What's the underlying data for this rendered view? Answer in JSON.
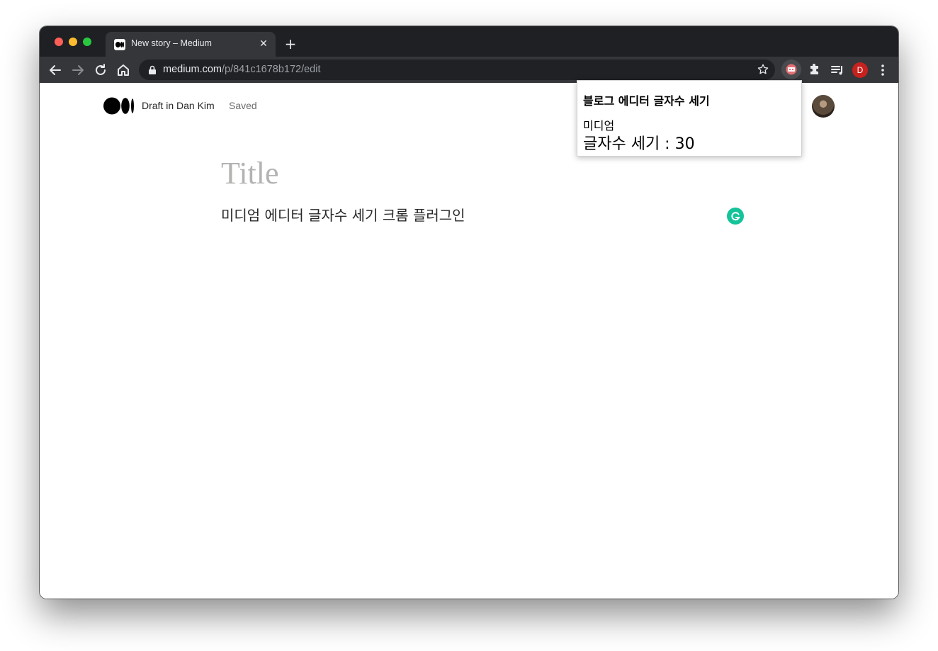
{
  "browser": {
    "tab": {
      "title": "New story – Medium",
      "close_glyph": "✕"
    },
    "new_tab_glyph": "+",
    "url": {
      "host": "medium.com",
      "path": "/p/841c1678b172/edit"
    },
    "profile_initial": "D",
    "icons": [
      "back-icon",
      "forward-icon",
      "reload-icon",
      "home-icon",
      "lock-icon",
      "bookmark-star-icon",
      "extension-icon",
      "puzzle-icon",
      "media-queue-icon",
      "more-icon"
    ]
  },
  "editor": {
    "draft_label": "Draft in Dan Kim",
    "status_label": "Saved",
    "title_placeholder": "Title",
    "body_text": "미디엄 에디터 글자수 세기 크롬 플러그인"
  },
  "extension_popup": {
    "title": "블로그 에디터 글자수 세기",
    "site": "미디엄",
    "count_text": "글자수 세기 : 30"
  },
  "colors": {
    "titlebar": "#1f2023",
    "toolbar": "#35363a",
    "omnibox": "#202124",
    "profile": "#c5221f",
    "grammarly": "#15c39a"
  }
}
